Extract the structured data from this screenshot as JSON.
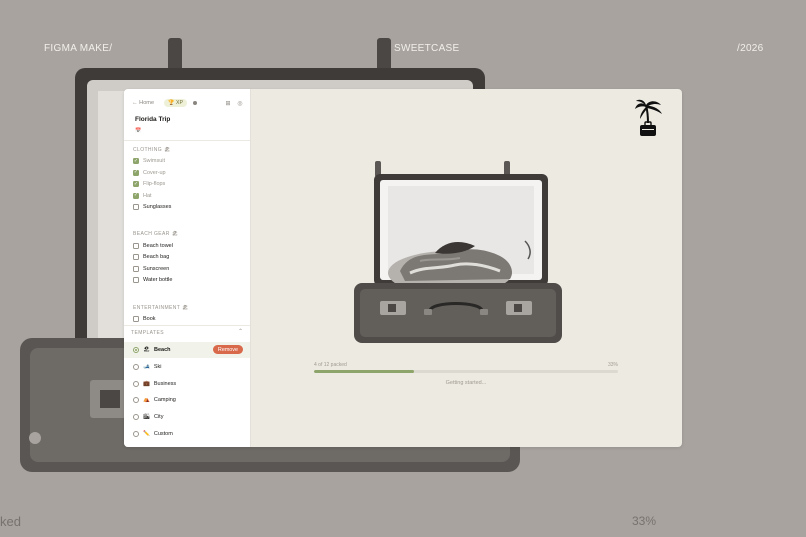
{
  "header": {
    "left": "FIGMA MAKE/",
    "center": "SWEETCASE",
    "right": "/2026"
  },
  "footer": {
    "left": "ked",
    "right": "33%"
  },
  "sidebar": {
    "home": "← Home",
    "xp": "🏆 XP",
    "icons": [
      "settings-icon",
      "grid-icon",
      "palette-icon"
    ],
    "trip_title": "Florida Trip",
    "trip_icon": "📅",
    "sections": [
      {
        "title": "CLOTHING 🏖",
        "items": [
          {
            "label": "Swimsuit",
            "checked": true
          },
          {
            "label": "Cover-up",
            "checked": true
          },
          {
            "label": "Flip-flops",
            "checked": true
          },
          {
            "label": "Hat",
            "checked": true
          },
          {
            "label": "Sunglasses",
            "checked": false
          }
        ]
      },
      {
        "title": "BEACH GEAR 🏖",
        "items": [
          {
            "label": "Beach towel",
            "checked": false
          },
          {
            "label": "Beach bag",
            "checked": false
          },
          {
            "label": "Sunscreen",
            "checked": false
          },
          {
            "label": "Water bottle",
            "checked": false
          }
        ]
      },
      {
        "title": "ENTERTAINMENT 🏖",
        "items": [
          {
            "label": "Book",
            "checked": false
          }
        ]
      }
    ],
    "templates_title": "TEMPLATES",
    "templates": [
      {
        "emoji": "🏖",
        "label": "Beach",
        "active": true
      },
      {
        "emoji": "🎿",
        "label": "Ski",
        "active": false
      },
      {
        "emoji": "💼",
        "label": "Business",
        "active": false
      },
      {
        "emoji": "⛺",
        "label": "Camping",
        "active": false
      },
      {
        "emoji": "🏙",
        "label": "City",
        "active": false
      },
      {
        "emoji": "✏️",
        "label": "Custom",
        "active": false
      }
    ],
    "remove_label": "Remove"
  },
  "main": {
    "progress_text": "4 of 12 packed",
    "progress_percent": "33%",
    "progress_value": 0.33,
    "status": "Getting started..."
  },
  "colors": {
    "accent": "#8da46a",
    "remove": "#d9694b",
    "card_bg": "#edeae1",
    "page_bg": "#a8a39f"
  }
}
